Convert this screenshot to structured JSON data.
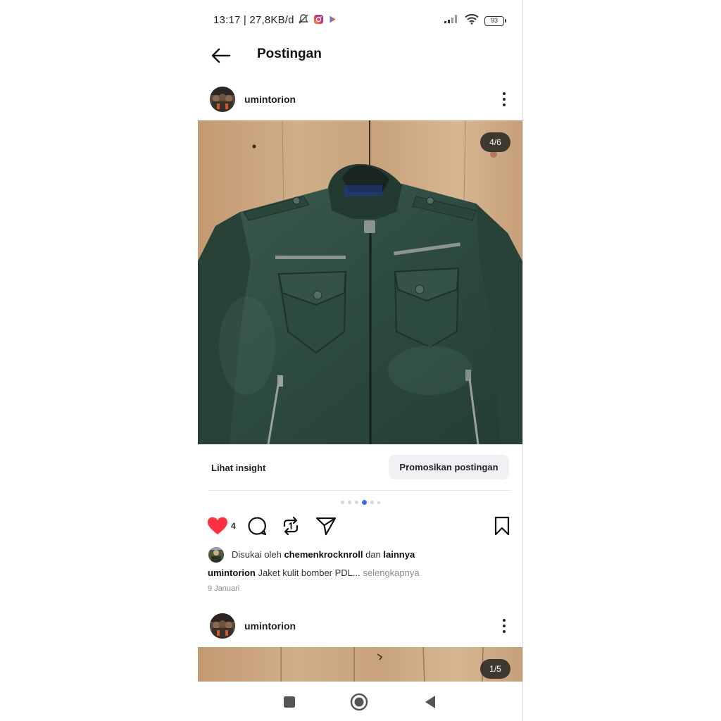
{
  "status_bar": {
    "time": "13:17 | 27,8KB/d",
    "battery": "93",
    "icons": [
      "silent-bell-icon",
      "instagram-app-icon",
      "play-store-icon",
      "signal-icon",
      "wifi-icon",
      "battery-icon"
    ]
  },
  "header": {
    "title": "Postingan",
    "back_icon": "arrow-left-icon"
  },
  "posts": [
    {
      "username": "umintorion",
      "image_counter": "4/6",
      "image_subject": "green leather jacket on wooden boards",
      "insight_label": "Lihat insight",
      "promote_label": "Promosikan postingan",
      "carousel": {
        "count": 6,
        "active_index": 3
      },
      "likes": "4",
      "liked_by_prefix": "Disukai oleh",
      "liked_by_user": "chemenkrocknroll",
      "liked_by_joiner": "dan",
      "liked_by_rest": "lainnya",
      "caption_user": "umintorion",
      "caption_text": "Jaket kulit bomber PDL...",
      "caption_more": "selengkapnya",
      "date": "9 Januari"
    },
    {
      "username": "umintorion",
      "image_counter": "1/5"
    }
  ],
  "colors": {
    "like_red": "#ff3040",
    "carousel_active": "#3d6ee8",
    "promote_bg": "#eff1f5",
    "wood": "#c7a17a",
    "jacket": "#2f4a40"
  },
  "nav": {
    "icons": [
      "recent-apps-icon",
      "home-icon",
      "back-triangle-icon"
    ]
  }
}
